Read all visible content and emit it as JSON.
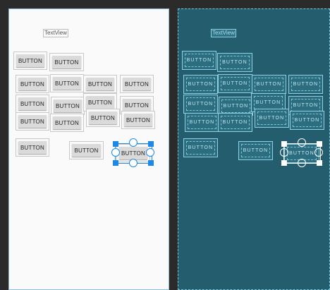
{
  "textview_label": "TextView",
  "button_label": "BUTTON",
  "colors": {
    "editor_bg": "#2b2b2b",
    "design_surface": "#fafafa",
    "blueprint_surface": "#235d6e",
    "selection": "#1e88e5"
  }
}
